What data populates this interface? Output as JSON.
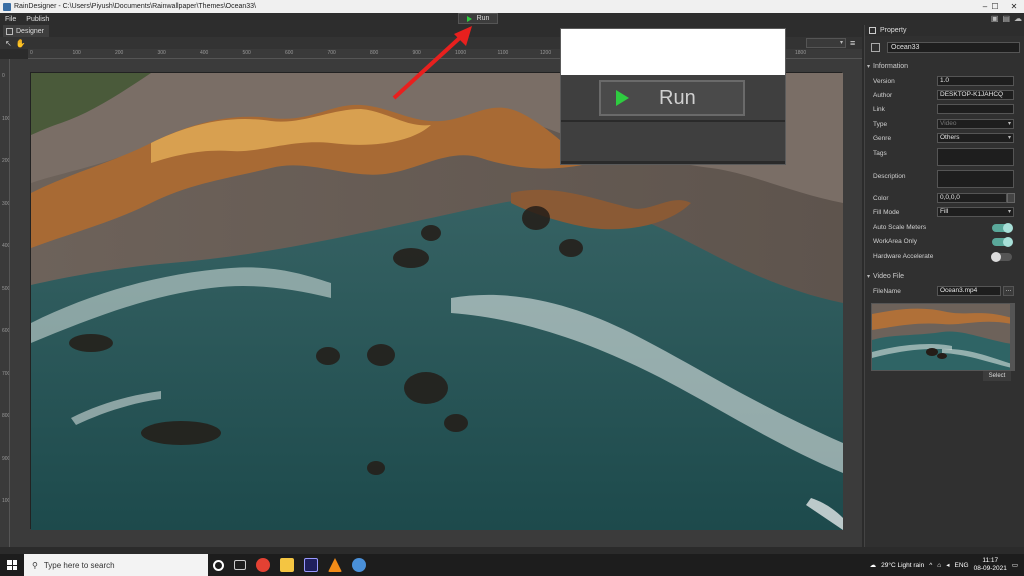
{
  "window": {
    "title": "RainDesigner - C:\\Users\\Piyush\\Documents\\Rainwallpaper\\Themes\\Ocean33\\",
    "minimize": "–",
    "maximize": "☐",
    "close": "✕"
  },
  "menu": [
    "File",
    "Publish"
  ],
  "run_button": {
    "label": "Run"
  },
  "designer_tab": {
    "label": "Designer"
  },
  "toolbar": {
    "tools": [
      "pointer-tool",
      "hand-tool"
    ]
  },
  "ruler_top": [
    "0",
    "100",
    "200",
    "300",
    "400",
    "500",
    "600",
    "700",
    "800",
    "900",
    "1000",
    "1100",
    "1200",
    "1300",
    "1400",
    "1500",
    "1600",
    "1700",
    "1800"
  ],
  "ruler_left": [
    "0",
    "100",
    "200",
    "300",
    "400",
    "500",
    "600",
    "700",
    "800",
    "900",
    "1000"
  ],
  "popup": {
    "run_label": "Run"
  },
  "panel": {
    "title": "Property",
    "name": "Ocean33",
    "information": {
      "header": "Information",
      "rows": [
        {
          "label": "Version",
          "value": "1.0"
        },
        {
          "label": "Author",
          "value": "DESKTOP-K1JAHCQ"
        },
        {
          "label": "Link",
          "value": ""
        },
        {
          "label": "Type",
          "value": "Video"
        },
        {
          "label": "Genre",
          "value": "Others"
        },
        {
          "label": "Tags",
          "value": ""
        },
        {
          "label": "Description",
          "value": ""
        },
        {
          "label": "Color",
          "value": "0,0,0,0"
        },
        {
          "label": "Fill Mode",
          "value": "Fill"
        }
      ],
      "toggles": [
        {
          "label": "Auto Scale Meters",
          "on": true
        },
        {
          "label": "WorkArea Only",
          "on": true
        },
        {
          "label": "Hardware Accelerate",
          "on": false
        }
      ]
    },
    "video": {
      "header": "Video File",
      "filename_label": "FileName",
      "filename": "Ocean3.mp4",
      "browse": "...",
      "select": "Select"
    }
  },
  "taskbar": {
    "search_placeholder": "Type here to search",
    "weather": "29°C  Light rain",
    "lang": "ENG",
    "time": "11:17",
    "date": "08-09-2021"
  },
  "colors": {
    "accent_green": "#2ecc40",
    "toggle_on": "#5aa89a",
    "arrow": "#e8201e"
  }
}
